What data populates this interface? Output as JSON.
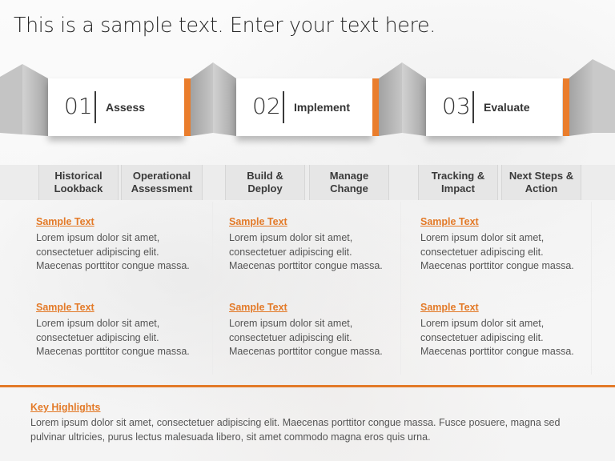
{
  "title": "This is a sample text. Enter your text here.",
  "colors": {
    "accent": "#e37a28",
    "text": "#333333",
    "ribbon_gray": "#a9a9a9"
  },
  "stages": [
    {
      "number": "01",
      "label": "Assess"
    },
    {
      "number": "02",
      "label": "Implement"
    },
    {
      "number": "03",
      "label": "Evaluate"
    }
  ],
  "substeps": [
    {
      "line1": "Historical",
      "line2": "Lookback"
    },
    {
      "line1": "Operational",
      "line2": "Assessment"
    },
    {
      "line1": "Build &",
      "line2": "Deploy"
    },
    {
      "line1": "Manage",
      "line2": "Change"
    },
    {
      "line1": "Tracking &",
      "line2": "Impact"
    },
    {
      "line1": "Next Steps &",
      "line2": "Action"
    }
  ],
  "columns": [
    {
      "blocks": [
        {
          "heading": "Sample Text",
          "lines": [
            "Lorem ipsum dolor sit amet,",
            "consectetuer adipiscing elit.",
            "Maecenas porttitor congue massa."
          ]
        },
        {
          "heading": "Sample Text",
          "lines": [
            "Lorem ipsum dolor sit amet,",
            "consectetuer adipiscing elit.",
            "Maecenas porttitor congue massa."
          ]
        }
      ]
    },
    {
      "blocks": [
        {
          "heading": "Sample Text",
          "lines": [
            "Lorem ipsum dolor sit amet,",
            "consectetuer adipiscing elit.",
            "Maecenas porttitor congue massa."
          ]
        },
        {
          "heading": "Sample Text",
          "lines": [
            "Lorem ipsum dolor sit amet,",
            "consectetuer adipiscing elit.",
            "Maecenas porttitor congue massa."
          ]
        }
      ]
    },
    {
      "blocks": [
        {
          "heading": "Sample Text",
          "lines": [
            "Lorem ipsum dolor sit amet,",
            "consectetuer adipiscing elit.",
            "Maecenas porttitor congue massa."
          ]
        },
        {
          "heading": "Sample Text",
          "lines": [
            "Lorem ipsum dolor sit amet,",
            "consectetuer adipiscing elit.",
            "Maecenas porttitor congue massa."
          ]
        }
      ]
    }
  ],
  "key_highlights": {
    "heading": "Key Highlights",
    "line1": "Lorem ipsum dolor sit amet, consectetuer adipiscing elit. Maecenas porttitor congue massa. Fusce posuere, magna sed",
    "line2": "pulvinar ultricies, purus lectus malesuada libero, sit amet commodo magna eros quis urna."
  }
}
